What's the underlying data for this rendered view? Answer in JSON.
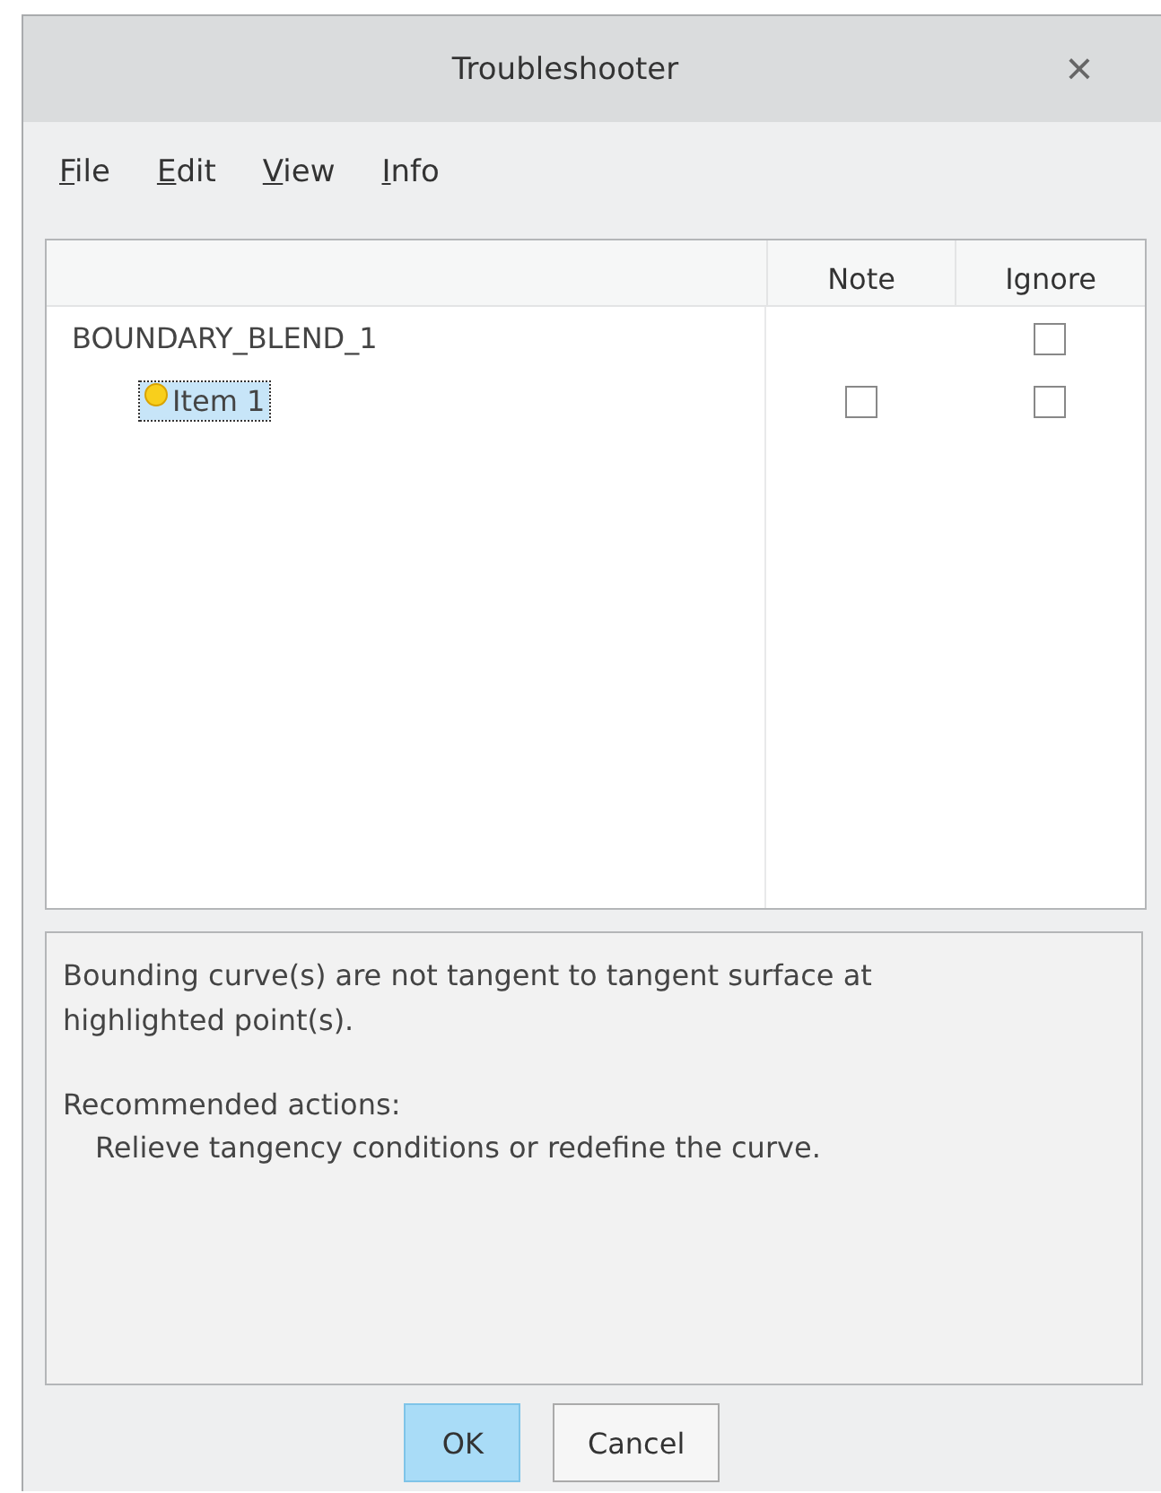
{
  "window": {
    "title": "Troubleshooter",
    "close": "×"
  },
  "menu": [
    {
      "label": "File"
    },
    {
      "label": "Edit"
    },
    {
      "label": "View"
    },
    {
      "label": "Info"
    }
  ],
  "tree": {
    "columns": [
      "Note",
      "Ignore"
    ],
    "items": [
      {
        "label": "BOUNDARY_BLEND_1",
        "selected": false,
        "ignore": {
          "checked": false
        },
        "children": [
          {
            "label": "Item 1",
            "selected": true,
            "note": {
              "checked": false
            },
            "ignore": {
              "checked": false
            }
          }
        ]
      }
    ]
  },
  "message": {
    "lines": [
      "Bounding curve(s) are not tangent to tangent surface at highlighted point(s)."
    ],
    "heading": "Recommended actions:",
    "actions": [
      "Relieve tangency conditions or redefine the curve."
    ]
  },
  "buttons": [
    {
      "label": "OK",
      "default": true
    },
    {
      "label": "Cancel",
      "default": false
    }
  ]
}
